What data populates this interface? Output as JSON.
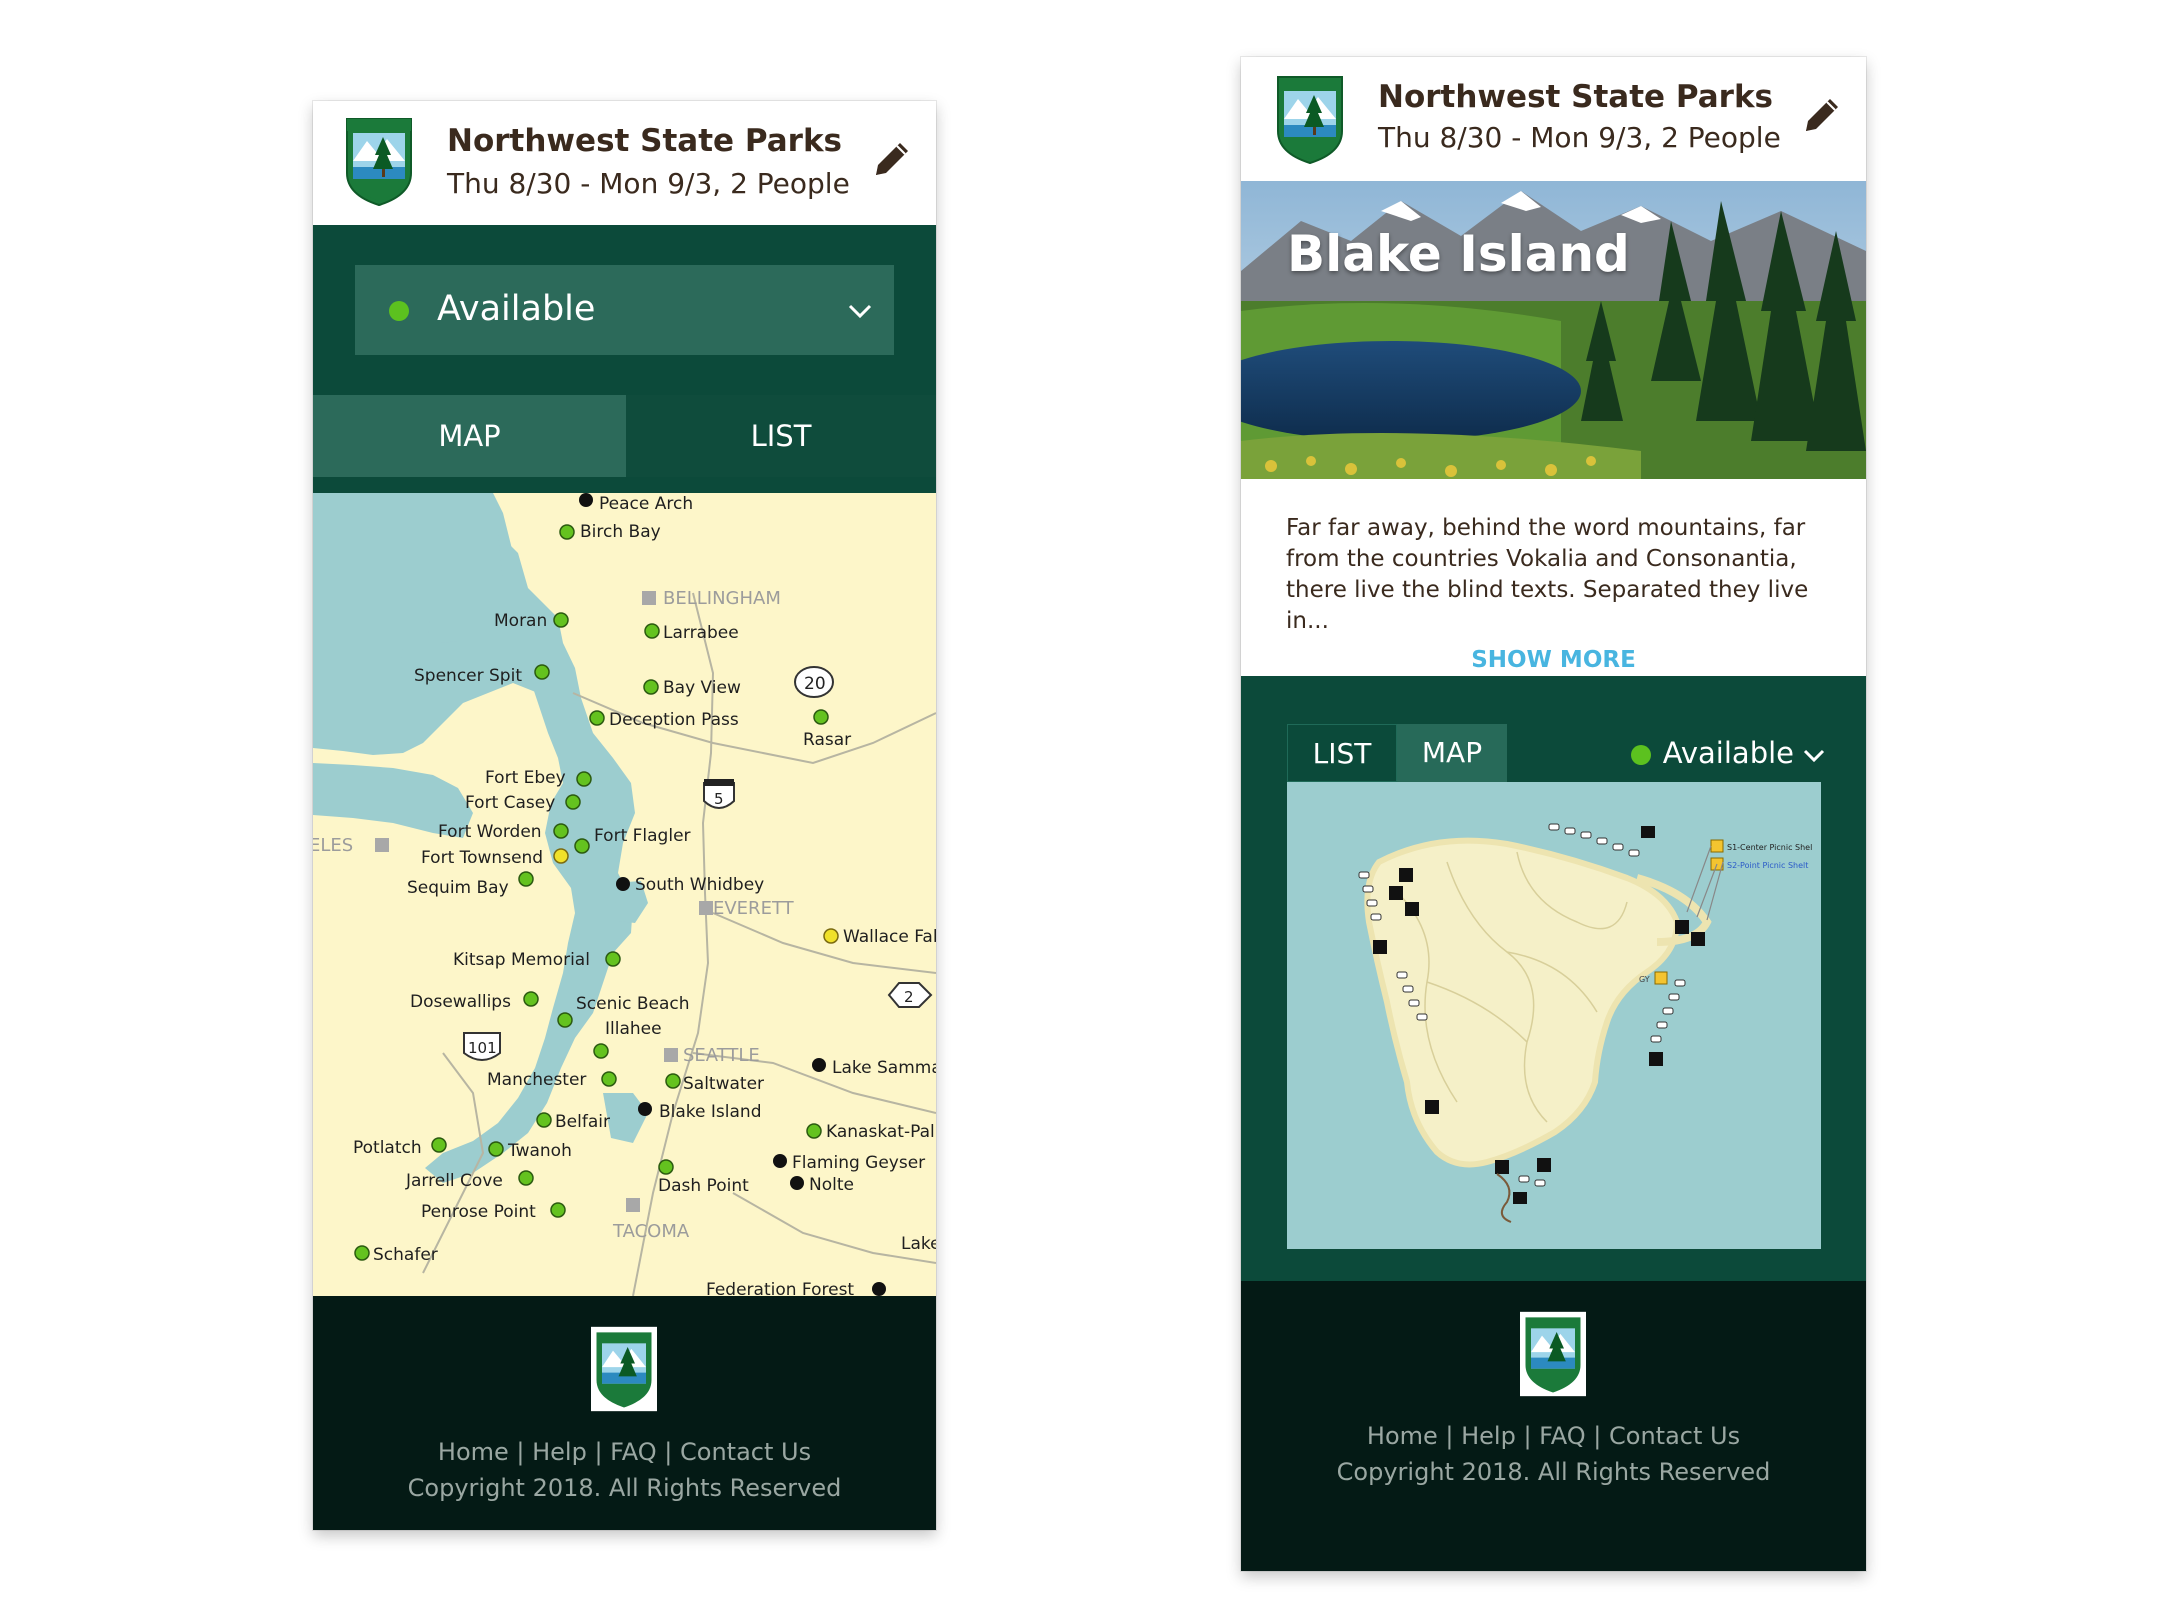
{
  "app": {
    "title": "Northwest State Parks",
    "dates": "Thu 8/30 - Mon 9/3, 2 People"
  },
  "left": {
    "filter": {
      "selected": "Available"
    },
    "tabs": {
      "map": "MAP",
      "list": "LIST"
    },
    "map": {
      "cities": [
        "BELLINGHAM",
        "EVERETT",
        "SEATTLE",
        "TACOMA",
        "ELES"
      ],
      "highway_shields": [
        "20",
        "5",
        "101",
        "2"
      ],
      "parks": [
        "Peace Arch",
        "Birch Bay",
        "Moran",
        "Larrabee",
        "Spencer Spit",
        "Bay View",
        "Deception Pass",
        "Rasar",
        "Fort Ebey",
        "Fort Casey",
        "Fort Worden",
        "Fort Flagler",
        "Fort Townsend",
        "Sequim Bay",
        "South Whidbey",
        "Wallace Fal",
        "Kitsap Memorial",
        "Dosewallips",
        "Scenic Beach",
        "Illahee",
        "Lake Samma",
        "Manchester",
        "Saltwater",
        "Blake Island",
        "Belfair",
        "Kanaskat-Pal",
        "Potlatch",
        "Twanoh",
        "Flaming Geyser",
        "Jarrell Cove",
        "Dash Point",
        "Nolte",
        "Penrose Point",
        "Schafer",
        "Lake",
        "Federation Forest"
      ]
    }
  },
  "right": {
    "park_name": "Blake Island",
    "description": "Far far away, behind the word mountains, far from the countries Vokalia and Consonantia, there live the blind texts. Separated they live in...",
    "show_more": "SHOW MORE",
    "tabs": {
      "list": "LIST",
      "map": "MAP"
    },
    "filter": {
      "selected": "Available"
    },
    "map_legend": [
      "S1-Center Picnic Shel",
      "S2-Point Picnic Shelt"
    ],
    "map_small_label": "GY"
  },
  "footer": {
    "links": [
      "Home",
      "Help",
      "FAQ",
      "Contact Us"
    ],
    "separator": " | ",
    "copyright": "Copyright 2018. All Rights Reserved"
  },
  "colors": {
    "brand_green": "#0c4a3a",
    "tab_active": "#2c6a5a",
    "footer_dark": "#041a15",
    "available_dot": "#5cc11f",
    "link_blue": "#48b5e0",
    "map_land": "#fdf6c9",
    "map_water": "#9ccdcf"
  },
  "icons": [
    "washington-parks-logo-icon",
    "pencil-edit-icon",
    "chevron-down-icon",
    "status-dot-icon"
  ]
}
